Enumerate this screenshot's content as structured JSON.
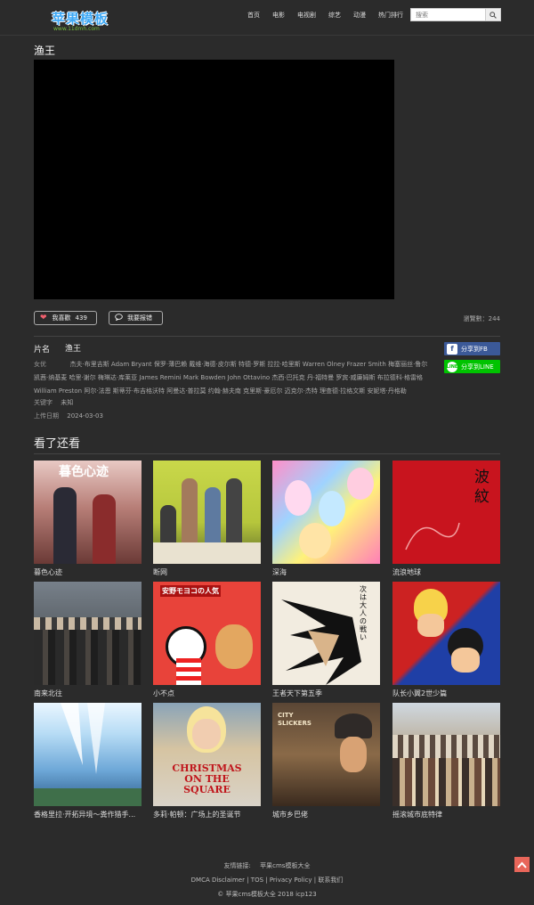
{
  "header": {
    "logo_text": "苹果模板",
    "logo_sub": "www.11dmh.com",
    "nav": [
      "首页",
      "电影",
      "电视剧",
      "综艺",
      "动漫",
      "热门排行"
    ],
    "search_placeholder": "搜索"
  },
  "video": {
    "title": "渔王",
    "like_label": "我喜歡",
    "like_count": "439",
    "report_label": "我要报错",
    "views_text": "瀏覽數：244"
  },
  "info": {
    "name_label": "片名",
    "name_value": "渔王",
    "cast_label": "女优",
    "cast_value": "杰夫·布里吉斯 Adam Bryant 保罗·薄巴赖 戴维·海德·皮尔斯 特德·罗斯 拉拉·哈里斯 Warren Olney Frazer Smith 梅塞丽丝·鲁尔 凯茜·纳基麦 哈里·谢尔 梅琳达·库莱亚 James Remini Mark Bowden John Ottavino 杰西·巴托克 丹·福特曼 罗宾·威廉姆斯 布拉德科·格雷格 William Preston 阿尔·法恩 斯蒂芬·布吉格沃特 阿曼达·普拉莫 约翰·赫夫南 克里斯·豪厄尔 迈克尔·杰特 理查德·拉格文斯 安妮塔·丹格勒",
    "keyword_label": "关键字",
    "keyword_value": "未知",
    "date_label": "上传日期",
    "date_value": "2024-03-03"
  },
  "share": {
    "fb_label": "分享到FB",
    "line_label": "分享到LINE"
  },
  "related": {
    "title": "看了还看",
    "items": [
      {
        "name": "暮色心迹",
        "poster_text": "暮色心迹"
      },
      {
        "name": "断网",
        "poster_text": ""
      },
      {
        "name": "深海",
        "poster_text": ""
      },
      {
        "name": "流浪地球",
        "poster_text": "波紋"
      },
      {
        "name": "南来北往",
        "poster_text": ""
      },
      {
        "name": "小不点",
        "poster_text": "安野モヨコの人気"
      },
      {
        "name": "王者天下第五季",
        "poster_text": "次は大人の戦い"
      },
      {
        "name": "队长小翼2世少篇",
        "poster_text": ""
      },
      {
        "name": "香格里拉·开拓异境～粪作猎手...",
        "poster_text": ""
      },
      {
        "name": "多莉·帕顿：广场上的圣诞节",
        "poster_text": "CHRISTMAS ON THE SQUARE"
      },
      {
        "name": "城市乡巴佬",
        "poster_text": "CITY SLICKERS"
      },
      {
        "name": "摇滚城市底特律",
        "poster_text": ""
      }
    ]
  },
  "footer": {
    "friend_label": "友情链接:",
    "friend_link": "苹果cms模板大全",
    "links": "DMCA Disclaimer | TOS | Privacy Policy | 联系我们",
    "copyright": "© 苹果cms模板大全 2018 icp123"
  }
}
